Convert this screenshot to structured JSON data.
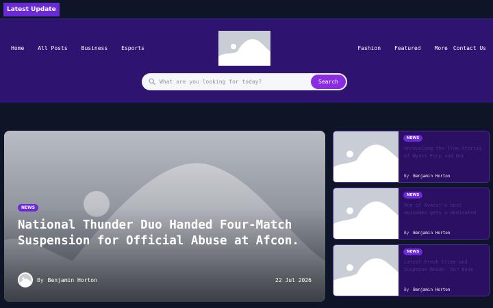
{
  "topbar": {
    "latest_label": "Latest Update"
  },
  "nav": {
    "left": [
      "Home",
      "All Posts",
      "Business",
      "Esports"
    ],
    "right": [
      "Fashion",
      "Featured",
      "More",
      "Contact Us"
    ]
  },
  "search": {
    "placeholder": "What are you looking for today?",
    "button_label": "Search"
  },
  "feature": {
    "tag": "NEWS",
    "title": "National Thunder Duo Handed Four-Match Suspension for Official Abuse at Afcon.",
    "by_label": "By",
    "author": "Benjamin Horton",
    "date": "22 Jul 2026"
  },
  "side_posts": [
    {
      "tag": "NEWS",
      "title": "Unraveling the True Stories of Wyatt Earp and Doc Holliday",
      "by_label": "By",
      "author": "Benjamin Horton"
    },
    {
      "tag": "NEWS",
      "title": "One of Avatar's best episodes gets a dedicated sequel story",
      "by_label": "By",
      "author": "Benjamin Horton"
    },
    {
      "tag": "NEWS",
      "title": "Latest Fresh Crime and Suspense Reads: Our Book Picks",
      "by_label": "By",
      "author": "Benjamin Horton"
    }
  ],
  "colors": {
    "accent": "#8b2be2",
    "header_bg": "#2f1370",
    "page_bg": "#0e1527"
  },
  "icons": {
    "search": "search-icon",
    "image_placeholder": "image-placeholder-icon"
  }
}
